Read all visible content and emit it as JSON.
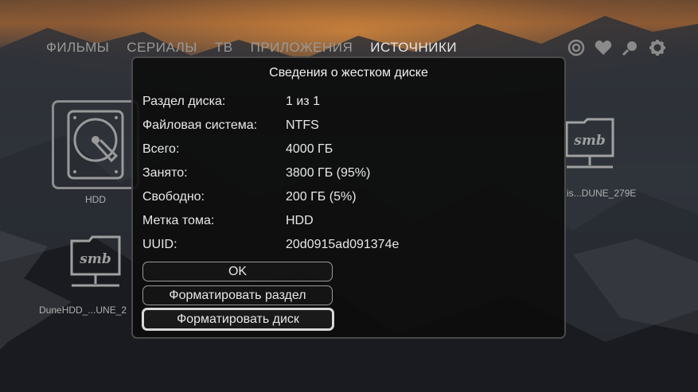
{
  "nav": {
    "tabs": [
      {
        "label": "ФИЛЬМЫ",
        "active": false
      },
      {
        "label": "СЕРИАЛЫ",
        "active": false
      },
      {
        "label": "ТВ",
        "active": false
      },
      {
        "label": "ПРИЛОЖЕНИЯ",
        "active": false
      },
      {
        "label": "ИСТОЧНИКИ",
        "active": true
      }
    ],
    "icons": [
      "target-icon",
      "heart-icon",
      "search-icon",
      "gear-icon"
    ]
  },
  "tiles": {
    "hdd_label": "HDD",
    "smb_right_label": "is...DUNE_279E",
    "smb_left_label": "DuneHDD_...UNE_2",
    "smb_text": "smb"
  },
  "dialog": {
    "title": "Сведения о жестком диске",
    "rows": [
      {
        "key": "Раздел диска:",
        "value": "1 из 1"
      },
      {
        "key": "Файловая система:",
        "value": "NTFS"
      },
      {
        "key": "Всего:",
        "value": "4000 ГБ"
      },
      {
        "key": "Занято:",
        "value": "3800 ГБ (95%)"
      },
      {
        "key": "Свободно:",
        "value": "200 ГБ (5%)"
      },
      {
        "key": "Метка тома:",
        "value": "HDD"
      },
      {
        "key": "UUID:",
        "value": "20d0915ad091374e"
      }
    ],
    "buttons": {
      "ok": "OK",
      "format_partition": "Форматировать раздел",
      "format_disk": "Форматировать диск"
    }
  }
}
